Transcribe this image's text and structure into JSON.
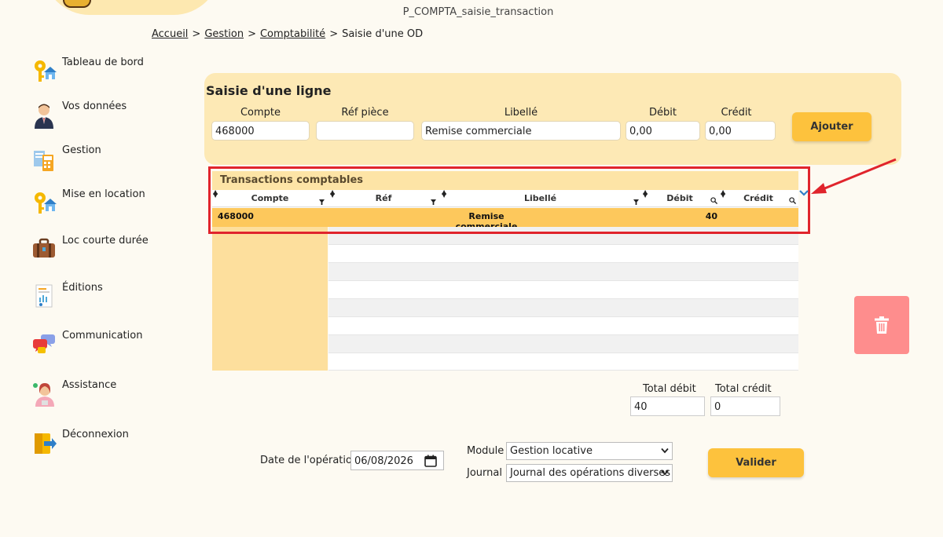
{
  "page": {
    "ref": "P_COMPTA_saisie_transaction"
  },
  "breadcrumb": {
    "items": [
      "Accueil",
      "Gestion",
      "Comptabilité"
    ],
    "current": "Saisie d'une OD",
    "separator": ">"
  },
  "sidebar": {
    "items": [
      {
        "label": "Tableau de bord",
        "icon": "key-house-icon"
      },
      {
        "label": "Vos données",
        "icon": "user-icon"
      },
      {
        "label": "Gestion",
        "icon": "calculator-documents-icon"
      },
      {
        "label": "Mise en location",
        "icon": "key-house-icon"
      },
      {
        "label": "Loc courte durée",
        "icon": "suitcase-icon"
      },
      {
        "label": "Éditions",
        "icon": "report-icon"
      },
      {
        "label": "Communication",
        "icon": "chat-bubbles-icon"
      },
      {
        "label": "Assistance",
        "icon": "headset-agent-icon"
      },
      {
        "label": "Déconnexion",
        "icon": "logout-icon"
      }
    ]
  },
  "entry": {
    "title": "Saisie d'une ligne",
    "labels": {
      "compte": "Compte",
      "ref": "Réf pièce",
      "libelle": "Libellé",
      "debit": "Débit",
      "credit": "Crédit"
    },
    "values": {
      "compte": "468000",
      "ref": "",
      "libelle": "Remise commerciale",
      "debit": "0,00",
      "credit": "0,00"
    },
    "add_label": "Ajouter"
  },
  "grid": {
    "title": "Transactions comptables",
    "columns": [
      "Compte",
      "Réf",
      "Libellé",
      "Débit",
      "Crédit"
    ],
    "rows": [
      {
        "compte": "468000",
        "ref": "",
        "libelle": "Remise commerciale",
        "debit": "40",
        "credit": ""
      }
    ]
  },
  "totals": {
    "debit_label": "Total débit",
    "credit_label": "Total crédit",
    "debit_value": "40",
    "credit_value": "0"
  },
  "operation": {
    "date_label": "Date de l'opération",
    "date_value": "06/08/2026",
    "module_label": "Module",
    "module_value": "Gestion locative",
    "journal_label": "Journal",
    "journal_value": "Journal des opérations diverses",
    "validate_label": "Valider"
  },
  "colors": {
    "background": "#fdfaf2",
    "panel": "#fde9b5",
    "button": "#fdc23d",
    "selected_row": "#fdc85c",
    "highlight_frame": "#e0242c",
    "delete_button": "#fe8d8d"
  }
}
